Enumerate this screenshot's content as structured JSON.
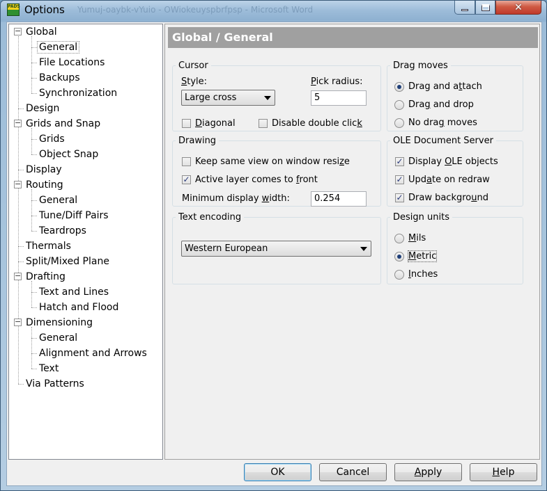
{
  "window": {
    "title": "Options",
    "app_icon_text": "PADS",
    "background_title": "Yumuj-oaybk-vYuio - OWiokeuyspbrfpsp - Microsoft Word"
  },
  "tree": [
    {
      "label": "Global",
      "level": 0,
      "expanded": true
    },
    {
      "label": "General",
      "level": 1,
      "selected": true
    },
    {
      "label": "File Locations",
      "level": 1
    },
    {
      "label": "Backups",
      "level": 1
    },
    {
      "label": "Synchronization",
      "level": 1
    },
    {
      "label": "Design",
      "level": 0
    },
    {
      "label": "Grids and Snap",
      "level": 0,
      "expanded": true
    },
    {
      "label": "Grids",
      "level": 1
    },
    {
      "label": "Object Snap",
      "level": 1
    },
    {
      "label": "Display",
      "level": 0
    },
    {
      "label": "Routing",
      "level": 0,
      "expanded": true
    },
    {
      "label": "General",
      "level": 1
    },
    {
      "label": "Tune/Diff Pairs",
      "level": 1
    },
    {
      "label": "Teardrops",
      "level": 1
    },
    {
      "label": "Thermals",
      "level": 0
    },
    {
      "label": "Split/Mixed Plane",
      "level": 0
    },
    {
      "label": "Drafting",
      "level": 0,
      "expanded": true
    },
    {
      "label": "Text and Lines",
      "level": 1
    },
    {
      "label": "Hatch and Flood",
      "level": 1
    },
    {
      "label": "Dimensioning",
      "level": 0,
      "expanded": true
    },
    {
      "label": "General",
      "level": 1
    },
    {
      "label": "Alignment and Arrows",
      "level": 1
    },
    {
      "label": "Text",
      "level": 1
    },
    {
      "label": "Via Patterns",
      "level": 0
    }
  ],
  "panel": {
    "header": "Global / General",
    "cursor": {
      "legend": "Cursor",
      "style_label_prefix": "",
      "style_label_u": "S",
      "style_label_rest": "tyle:",
      "style_value": "Large cross",
      "pick_label_u": "P",
      "pick_label_rest": "ick radius:",
      "pick_value": "5",
      "diagonal_u": "D",
      "diagonal_rest": "iagonal",
      "diagonal_checked": false,
      "disable_dbl_prefix": "Disable double clic",
      "disable_dbl_u": "k",
      "disable_dbl_checked": false
    },
    "drag_moves": {
      "legend": "Drag moves",
      "opt1_prefix": "Drag and a",
      "opt1_u": "t",
      "opt1_rest": "tach",
      "opt2_prefix": "Dra",
      "opt2_u": "g",
      "opt2_rest": " and drop",
      "opt3_prefix": "No dra",
      "opt3_u": "g",
      "opt3_rest": " moves",
      "selected": "attach"
    },
    "drawing": {
      "legend": "Drawing",
      "keep_prefix": "Keep same view on window resi",
      "keep_u": "z",
      "keep_rest": "e",
      "keep_checked": false,
      "active_prefix": "Active layer comes to ",
      "active_u": "f",
      "active_rest": "ront",
      "active_checked": true,
      "min_prefix": "Minimum display ",
      "min_u": "w",
      "min_rest": "idth:",
      "min_value": "0.254"
    },
    "ole": {
      "legend": "OLE Document Server",
      "display_prefix": "Display ",
      "display_u": "O",
      "display_rest": "LE objects",
      "display_checked": true,
      "update_prefix": "Upd",
      "update_u": "a",
      "update_rest": "te on redraw",
      "update_checked": true,
      "bg_prefix": "Draw backgro",
      "bg_u": "u",
      "bg_rest": "nd",
      "bg_checked": true
    },
    "text_encoding": {
      "legend": "Text encoding",
      "value": "Western European"
    },
    "design_units": {
      "legend": "Design units",
      "mils_u": "M",
      "mils_rest": "ils",
      "metric_prefix": "",
      "metric_u": "M",
      "metric_rest": "etric",
      "inches_u": "I",
      "inches_rest": "nches",
      "selected": "metric"
    }
  },
  "buttons": {
    "ok": "OK",
    "cancel": "Cancel",
    "apply_u": "A",
    "apply_rest": "pply",
    "help_u": "H",
    "help_rest": "elp"
  }
}
